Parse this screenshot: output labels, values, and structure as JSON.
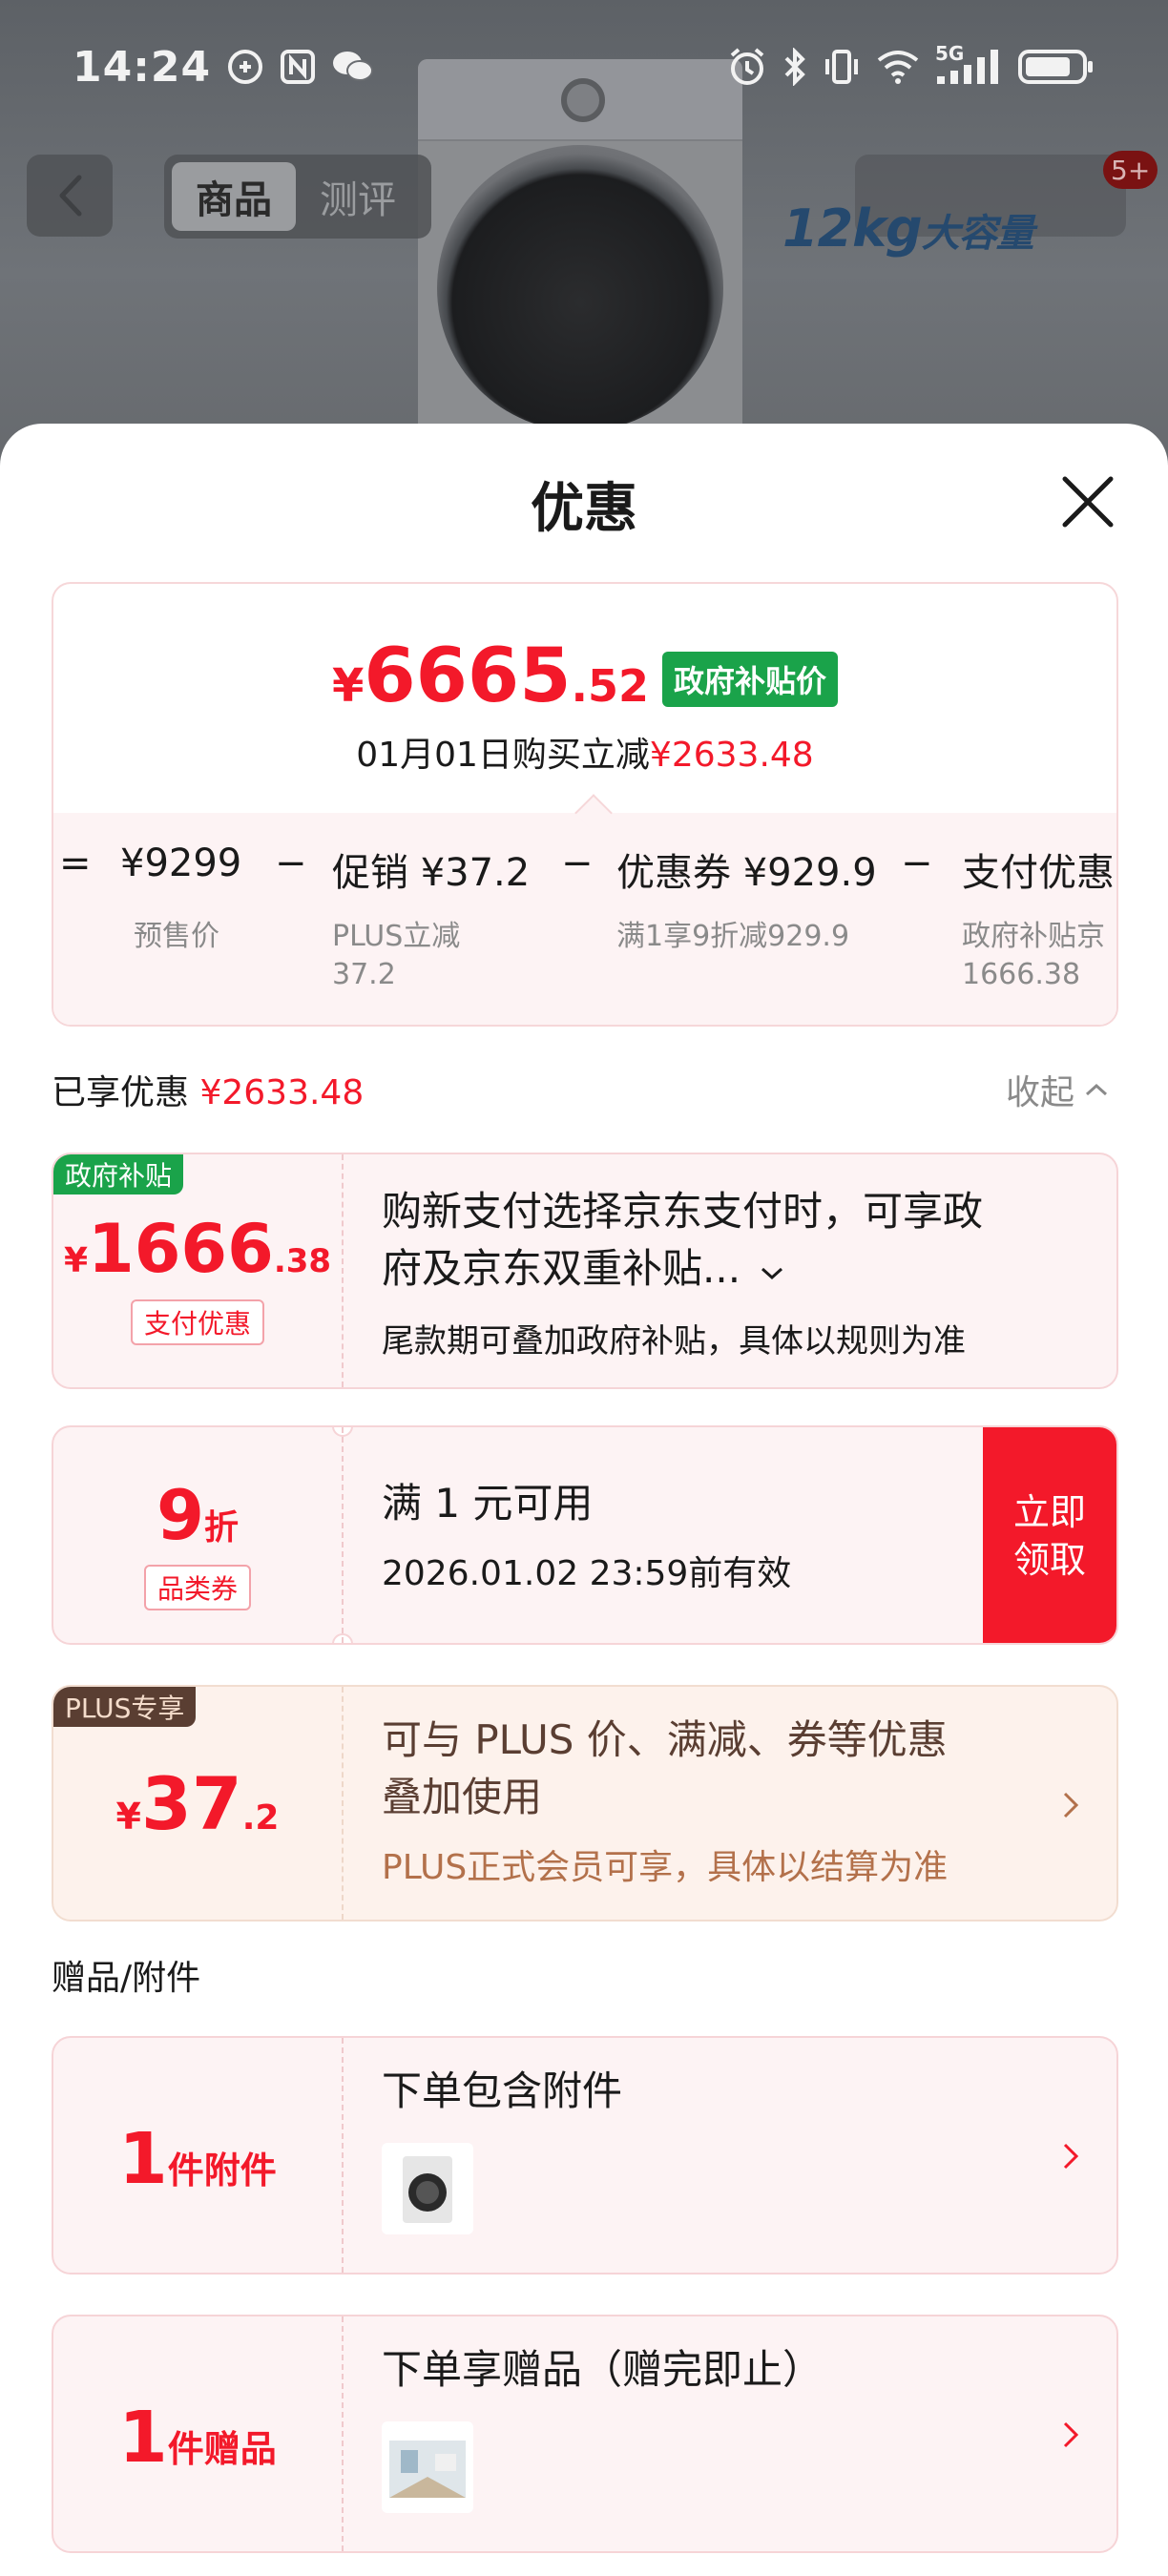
{
  "status_bar": {
    "time": "14:24",
    "network": "5G"
  },
  "background_page": {
    "tab_goods": "商品",
    "tab_review": "测评",
    "badge": "5+",
    "promo_text": "12kg",
    "promo_suffix": "大容量"
  },
  "sheet": {
    "title": "优惠"
  },
  "summary": {
    "price_currency": "¥",
    "price_integer": "6665",
    "price_decimal": ".52",
    "price_tag": "政府补贴价",
    "reduce_prefix": "01月01日购买立减",
    "reduce_amount": "¥2633.48",
    "formula": [
      {
        "op": "=",
        "label": "¥9299",
        "sub": "预售价"
      },
      {
        "op": "−",
        "label": "促销 ¥37.2",
        "sub1": "PLUS立减",
        "sub2": "37.2"
      },
      {
        "op": "−",
        "label": "优惠券 ¥929.9",
        "sub": "满1享9折减929.9"
      },
      {
        "op": "−",
        "label": "支付优惠",
        "sub1": "政府补贴京",
        "sub2": "1666.38"
      }
    ]
  },
  "enjoyed": {
    "label": "已享优惠",
    "amount": "¥2633.48",
    "collapse_label": "收起"
  },
  "coupons": {
    "gov": {
      "tag": "政府补贴",
      "currency": "¥",
      "integer": "1666",
      "decimal": ".38",
      "type_label": "支付优惠",
      "title_line1": "购新支付选择京东支付时，可享政",
      "title_line2": "府及京东双重补贴...",
      "desc": "尾款期可叠加政府补贴，具体以规则为准"
    },
    "category": {
      "amount": "9",
      "unit": "折",
      "type_label": "品类券",
      "title": "满 1 元可用",
      "validity": "2026.01.02 23:59前有效",
      "button_line1": "立即",
      "button_line2": "领取"
    },
    "plus": {
      "tag": "PLUS专享",
      "currency": "¥",
      "integer": "37",
      "decimal": ".2",
      "title_line1": "可与 PLUS 价、满减、券等优惠",
      "title_line2": "叠加使用",
      "desc": "PLUS正式会员可享，具体以结算为准"
    }
  },
  "gifts": {
    "section_label": "赠品/附件",
    "accessory": {
      "count": "1",
      "unit": "件附件",
      "title": "下单包含附件"
    },
    "gift": {
      "count": "1",
      "unit": "件赠品",
      "title": "下单享赠品（赠完即止）"
    }
  },
  "colors": {
    "accent_red": "#f3192a",
    "gov_green": "#1aa34a",
    "plus_brown": "#5a3e32"
  }
}
